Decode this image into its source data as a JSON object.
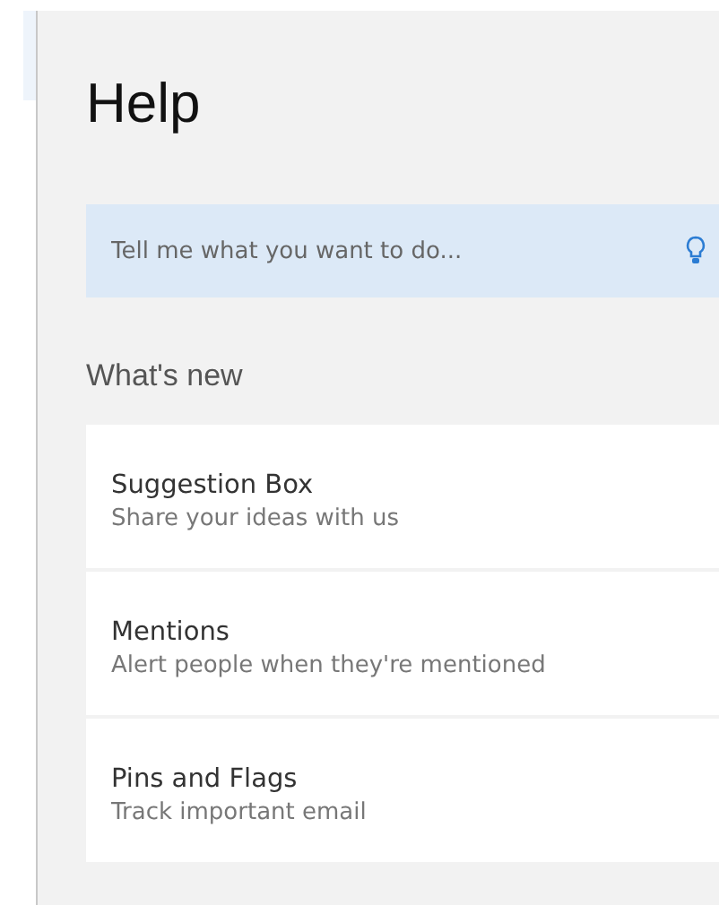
{
  "panel": {
    "title": "Help"
  },
  "search": {
    "placeholder": "Tell me what you want to do..."
  },
  "section": {
    "title": "What's new"
  },
  "items": [
    {
      "title": "Suggestion Box",
      "subtitle": "Share your ideas with us"
    },
    {
      "title": "Mentions",
      "subtitle": "Alert people when they're mentioned"
    },
    {
      "title": "Pins and Flags",
      "subtitle": "Track important email"
    }
  ]
}
